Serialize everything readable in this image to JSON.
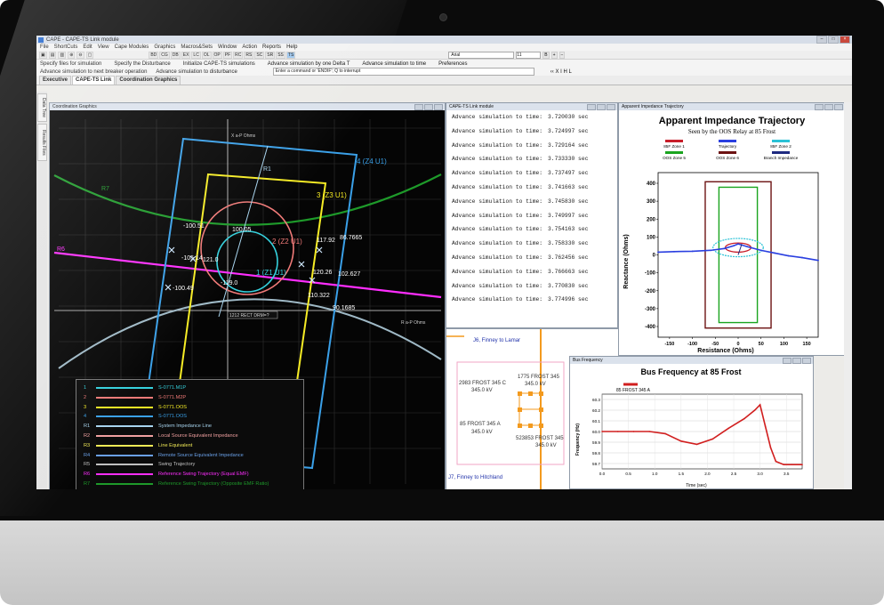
{
  "window": {
    "title": "CAPE - CAPE-TS Link module"
  },
  "menu": [
    "File",
    "ShortCuts",
    "Edit",
    "View",
    "Cape Modules",
    "Graphics",
    "Macros&Sets",
    "Window",
    "Action",
    "Reports",
    "Help"
  ],
  "toolbar": {
    "modules": [
      "BD",
      "CG",
      "DB",
      "EX",
      "LC",
      "OL",
      "OP",
      "PF",
      "RC",
      "RS",
      "SC",
      "SR",
      "SS",
      "TS"
    ],
    "font": "Arial",
    "font_size": "11"
  },
  "simulation": {
    "row1": [
      "Specify files for simulation",
      "Specify the Disturbance",
      "Initialize CAPE-TS simulations",
      "Advance simulation by one Delta T",
      "Advance simulation to time",
      "Preferences"
    ],
    "row2": [
      "Advance simulation to next breaker operation",
      "Advance simulation to disturbance"
    ],
    "command_placeholder": "Enter a command or 'ENDIF'; Q to interrupt"
  },
  "tabs": [
    "Executive",
    "CAPE-TS Link",
    "Coordination Graphics"
  ],
  "sidetabs": [
    "Data Tree",
    "Results Files"
  ],
  "coordination": {
    "title": "Coordination Graphics",
    "axis_x": "R a-P Ohms",
    "axis_y": "X a-P Ohms",
    "zone_labels": [
      "4 (Z4 U1)",
      "3 (Z3 U1)",
      "2 (Z2 U1)",
      "1 (Z1 U1)"
    ],
    "curve_labels": [
      "R7",
      "R6",
      "R1"
    ],
    "angle_labels": [
      "-100.51",
      "-105.14",
      "-100.49",
      "-119.0",
      "100.05",
      "121.0",
      "117.92",
      "86.7665",
      "120.26",
      "102.627",
      "110.322",
      "90.1685"
    ],
    "box_label": "1212 RECT DRM=?",
    "legend": [
      {
        "id": "1",
        "name": "S-0771.M1P",
        "color": "#35d1dd"
      },
      {
        "id": "2",
        "name": "S-0771.M2P",
        "color": "#f07a78"
      },
      {
        "id": "3",
        "name": "S-0771.OOS",
        "color": "#f6ec25"
      },
      {
        "id": "4",
        "name": "S-0771.OOS",
        "color": "#3aa0e8"
      },
      {
        "id": "R1",
        "name": "System Impedance Line",
        "color": "#a8d4ee"
      },
      {
        "id": "R2",
        "name": "Local Source Equivalent Impedance",
        "color": "#f0a0a0"
      },
      {
        "id": "R3",
        "name": "Line Equivalent",
        "color": "#f1ea56"
      },
      {
        "id": "R4",
        "name": "Remote Source Equivalent Impedance",
        "color": "#6aa0e8"
      },
      {
        "id": "R5",
        "name": "Swing Trajectory",
        "color": "#c0c0c0"
      },
      {
        "id": "R6",
        "name": "Reference Swing Trajectory (Equal EMF)",
        "color": "#ff2dff"
      },
      {
        "id": "R7",
        "name": "Reference Swing Trajectory (Opposite EMF Ratio)",
        "color": "#1e9a2a"
      }
    ]
  },
  "link": {
    "title": "CAPE-TS Link module",
    "log_prefix": "Advance simulation to time:",
    "times": [
      "3.720030 sec",
      "3.724997 sec",
      "3.729164 sec",
      "3.733330 sec",
      "3.737497 sec",
      "3.741663 sec",
      "3.745830 sec",
      "3.749997 sec",
      "3.754163 sec",
      "3.758330 sec",
      "3.762456 sec",
      "3.766663 sec",
      "3.770830 sec",
      "3.774996 sec"
    ]
  },
  "oneline": {
    "labels": [
      "J6, Finney to Lamar",
      "1775 FROST 345",
      "345.0 kV",
      "2983 FROST 345 C",
      "345.0 kV",
      "85 FROST 345 A",
      "345.0 kV",
      "523853 FROST 345",
      "345.0 kV",
      "J7, Finney to Hitchland"
    ]
  },
  "impedance": {
    "title": "Apparent Impedance Trajectory",
    "window_title": "Apparent Impedance Trajectory",
    "subtitle": "Seen by the OOS Relay at 85 Frost",
    "legend": [
      {
        "name": "85F Zone 1",
        "color": "#c81e2a"
      },
      {
        "name": "Trajectory",
        "color": "#2a3fe0"
      },
      {
        "name": "85F Zone 2",
        "color": "#2bc2d6"
      },
      {
        "name": "OOS Zone 5",
        "color": "#1aa41f"
      },
      {
        "name": "OOS Zone 6",
        "color": "#6c1212"
      },
      {
        "name": "Branch Impedance",
        "color": "#1e2a80"
      }
    ],
    "ylabel": "Reactance (Ohms)",
    "xlabel": "Resistance (Ohms)",
    "yticks": [
      "400",
      "300",
      "200",
      "100",
      "0",
      "-100",
      "-200",
      "-300",
      "-400"
    ],
    "xticks": [
      "-150",
      "-100",
      "-50",
      "0",
      "50",
      "100",
      "150"
    ]
  },
  "frequency": {
    "title": "Bus Frequency at 85 Frost",
    "window_title": "Bus Frequency",
    "legend": "85 FROST 345 A",
    "ylabel": "Frequency (Hz)",
    "xlabel": "Time (sec)",
    "yticks": [
      "60.3",
      "60.2",
      "60.1",
      "60.0",
      "59.9",
      "59.8",
      "59.7"
    ],
    "xticks": [
      "0.0",
      "0.5",
      "1.0",
      "1.5",
      "2.0",
      "2.5",
      "3.0",
      "3.5"
    ]
  },
  "chart_data": [
    {
      "type": "line",
      "title": "Apparent Impedance Trajectory",
      "xlabel": "Resistance (Ohms)",
      "ylabel": "Reactance (Ohms)",
      "xlim": [
        -175,
        175
      ],
      "ylim": [
        -450,
        450
      ],
      "series": [
        {
          "name": "Trajectory",
          "x": [
            -175,
            -140,
            -100,
            -60,
            -30,
            -10,
            0,
            20,
            50,
            80,
            110,
            140,
            175
          ],
          "y": [
            15,
            18,
            20,
            25,
            35,
            50,
            60,
            45,
            25,
            10,
            -5,
            -15,
            -30
          ]
        }
      ]
    },
    {
      "type": "line",
      "title": "Bus Frequency at 85 Frost",
      "xlabel": "Time (sec)",
      "ylabel": "Frequency (Hz)",
      "xlim": [
        0,
        3.8
      ],
      "ylim": [
        59.65,
        60.35
      ],
      "series": [
        {
          "name": "85 FROST 345 A",
          "x": [
            0,
            0.3,
            0.6,
            0.9,
            1.2,
            1.5,
            1.8,
            2.1,
            2.4,
            2.7,
            2.9,
            3.0,
            3.1,
            3.2,
            3.3,
            3.45,
            3.6,
            3.8
          ],
          "y": [
            60.0,
            60.0,
            60.0,
            60.0,
            59.98,
            59.91,
            59.88,
            59.93,
            60.03,
            60.12,
            60.2,
            60.25,
            60.05,
            59.85,
            59.72,
            59.69,
            59.69,
            59.69
          ]
        }
      ]
    }
  ]
}
